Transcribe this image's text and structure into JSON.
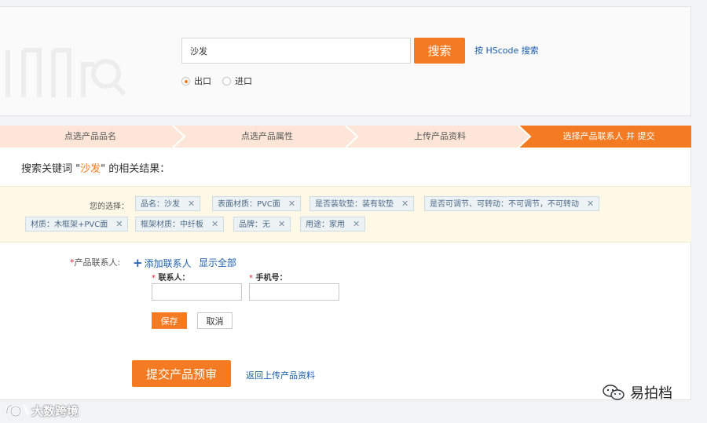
{
  "search": {
    "query": "沙发",
    "button_label": "搜索",
    "hscode_link": "按 HScode 搜索",
    "radio_options": [
      {
        "label": "出口",
        "selected": true
      },
      {
        "label": "进口",
        "selected": false
      }
    ]
  },
  "steps": [
    {
      "label": "点选产品品名",
      "state": "done"
    },
    {
      "label": "点选产品属性",
      "state": "done"
    },
    {
      "label": "上传产品资料",
      "state": "done"
    },
    {
      "label": "选择产品联系人 并 提交",
      "state": "active"
    }
  ],
  "result": {
    "prefix": "搜索关键词 \"",
    "keyword": "沙发",
    "suffix": "\" 的相关结果："
  },
  "filters": {
    "lead": "您的选择：",
    "tags": [
      "品名：沙发",
      "表面材质：PVC面",
      "是否装软垫：装有软垫",
      "是否可调节、可转动：不可调节，不可转动",
      "材质：木框架+PVC面",
      "框架材质：中纤板",
      "品牌：无",
      "用途：家用"
    ],
    "remove_symbol": "✕"
  },
  "contact_form": {
    "required_mark": "*",
    "row_label": "产品联系人:",
    "add_label": "添加联系人",
    "add_symbol": "+",
    "show_all": "显示全部",
    "name_label": "联系人：",
    "phone_label": "手机号：",
    "save": "保存",
    "cancel": "取消"
  },
  "footer": {
    "submit": "提交产品预审",
    "back": "返回上传产品资料"
  },
  "watermarks": {
    "left": "大数跨境",
    "right": "易拍档"
  },
  "colors": {
    "accent": "#f47b22",
    "link": "#1c5fad",
    "step_done": "#fde6d7",
    "step_active": "#f47b22"
  }
}
